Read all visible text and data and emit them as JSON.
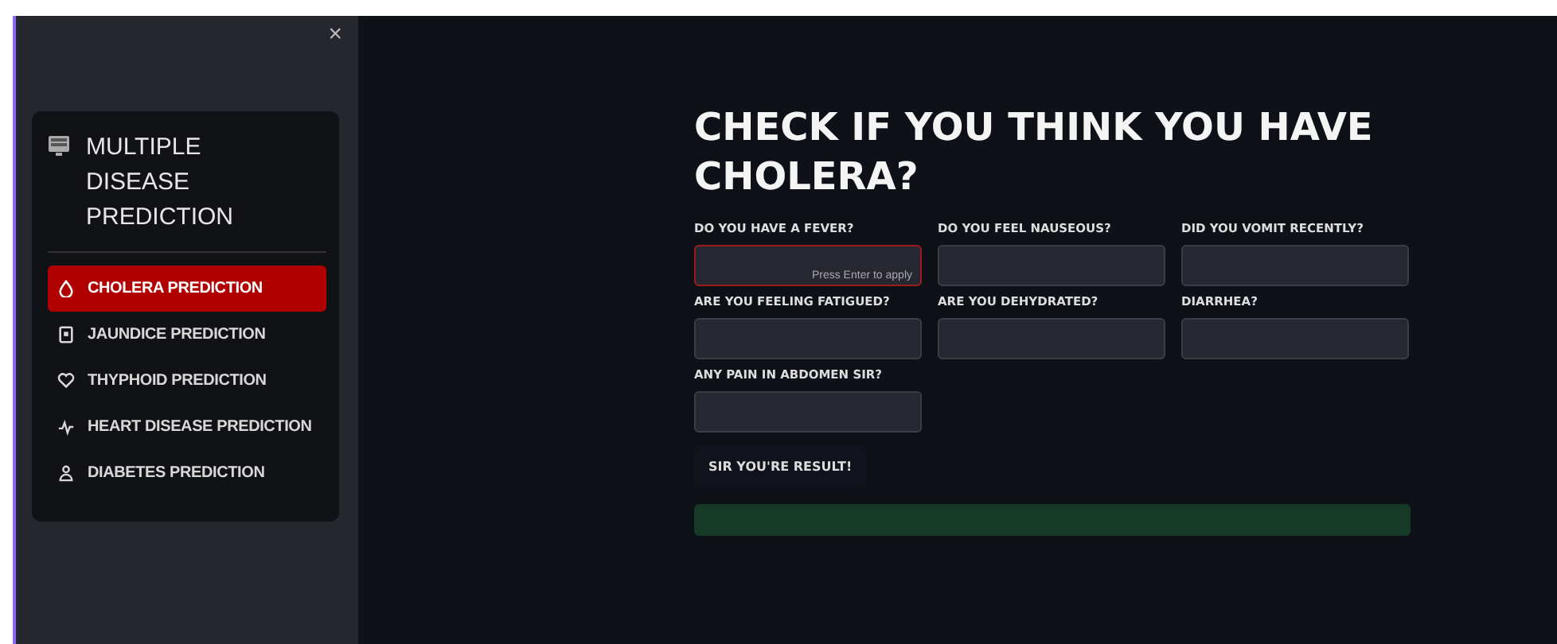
{
  "sidebar": {
    "close": "×",
    "menu": {
      "title": "MULTIPLE DISEASE PREDICTION",
      "items": [
        {
          "label": "CHOLERA PREDICTION",
          "selected": true
        },
        {
          "label": "JAUNDICE PREDICTION",
          "selected": false
        },
        {
          "label": "THYPHOID PREDICTION",
          "selected": false
        },
        {
          "label": "HEART DISEASE PREDICTION",
          "selected": false
        },
        {
          "label": "DIABETES PREDICTION",
          "selected": false
        }
      ]
    }
  },
  "main": {
    "title": "CHECK IF YOU THINK YOU HAVE CHOLERA?",
    "fields": [
      {
        "label": "DO YOU HAVE A FEVER?",
        "focused": true,
        "hint": "Press Enter to apply"
      },
      {
        "label": "DO YOU FEEL NAUSEOUS?",
        "focused": false
      },
      {
        "label": "DID YOU VOMIT RECENTLY?",
        "focused": false
      },
      {
        "label": "ARE YOU FEELING FATIGUED?",
        "focused": false
      },
      {
        "label": "ARE YOU DEHYDRATED?",
        "focused": false
      },
      {
        "label": "DIARRHEA?",
        "focused": false
      },
      {
        "label": "ANY PAIN IN ABDOMEN SIR?",
        "focused": false
      }
    ],
    "button": "SIR YOU'RE RESULT!",
    "result": {
      "kind": "success"
    }
  }
}
